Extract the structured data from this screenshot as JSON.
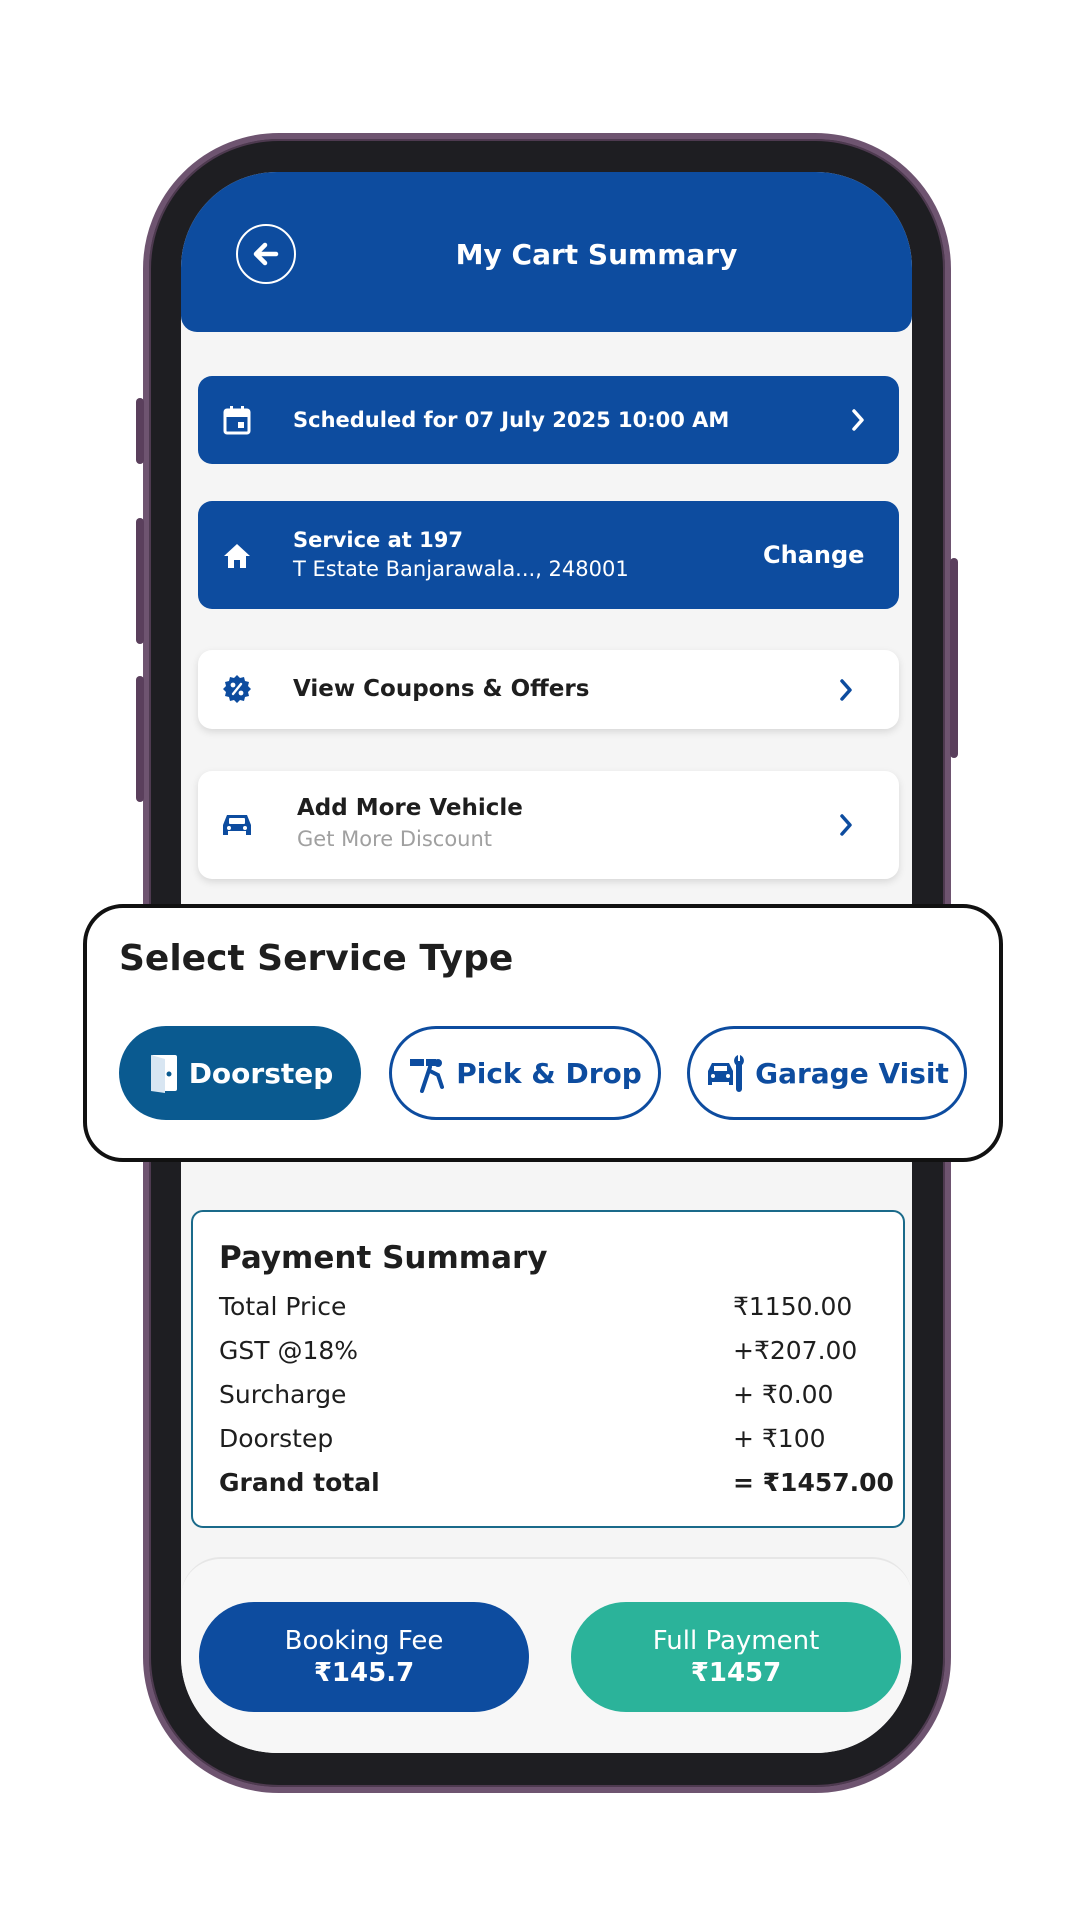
{
  "header": {
    "title": "My Cart Summary"
  },
  "schedule": {
    "label": "Scheduled for 07 July 2025 10:00 AM"
  },
  "address": {
    "title": "Service at 197",
    "line": "T Estate Banjarawala..., 248001",
    "change_label": "Change"
  },
  "coupons": {
    "label": "View Coupons & Offers"
  },
  "vehicle": {
    "title": "Add More Vehicle",
    "subtitle": "Get More Discount"
  },
  "service_type": {
    "title": "Select Service Type",
    "options": [
      {
        "label": "Doorstep",
        "icon": "door-icon",
        "selected": true
      },
      {
        "label": "Pick & Drop",
        "icon": "valet-icon",
        "selected": false
      },
      {
        "label": "Garage Visit",
        "icon": "car-wrench-icon",
        "selected": false
      }
    ]
  },
  "payment_summary": {
    "title": "Payment Summary",
    "rows": [
      {
        "label": "Total Price",
        "value": "₹1150.00"
      },
      {
        "label": "GST @18%",
        "value": "+₹207.00"
      },
      {
        "label": "Surcharge",
        "value": "+ ₹0.00"
      },
      {
        "label": "Doorstep",
        "value": "+ ₹100"
      }
    ],
    "grand_total": {
      "label": "Grand total",
      "value": "= ₹1457.00"
    }
  },
  "actions": {
    "booking_fee": {
      "label": "Booking Fee",
      "amount": "₹145.7"
    },
    "full_payment": {
      "label": "Full Payment",
      "amount": "₹1457"
    }
  },
  "colors": {
    "primary": "#0d4c9f",
    "selected_pill": "#0a5a90",
    "full_payment": "#2bb39a",
    "phone_frame": "#6e5470"
  }
}
